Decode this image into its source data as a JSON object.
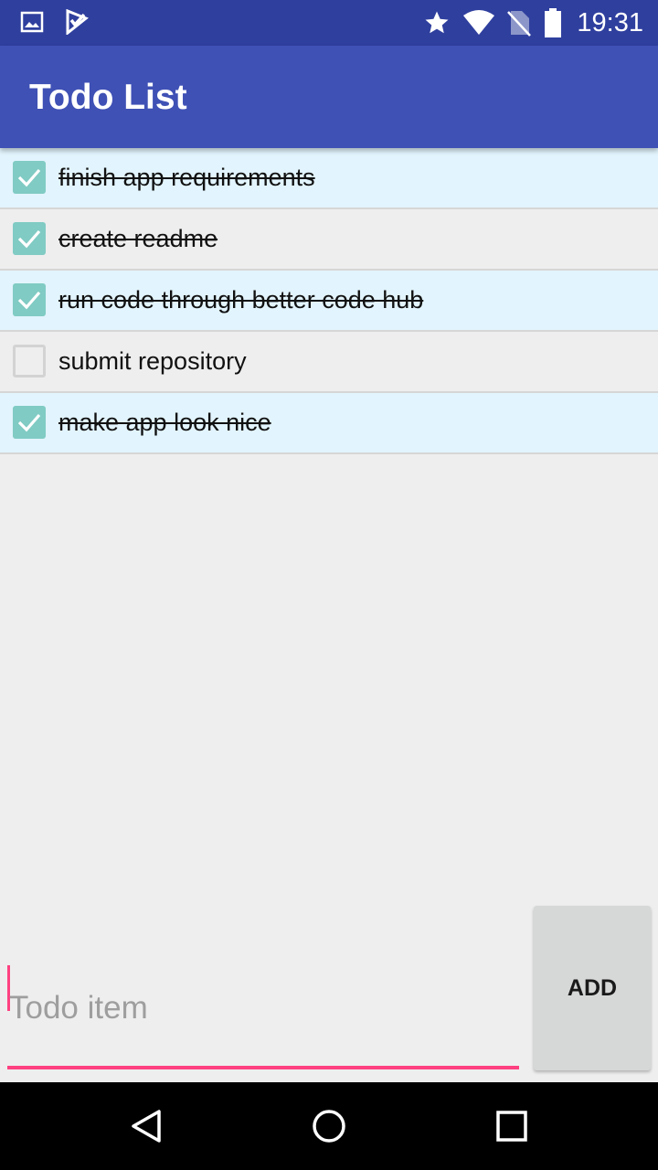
{
  "status_bar": {
    "time": "19:31",
    "icons": [
      "gallery-notification-icon",
      "app-notification-icon",
      "star-icon",
      "wifi-icon",
      "no-sim-icon",
      "battery-icon"
    ]
  },
  "app_bar": {
    "title": "Todo List"
  },
  "todos": [
    {
      "text": "finish app requirements",
      "done": true
    },
    {
      "text": "create readme",
      "done": true
    },
    {
      "text": "run code through better code hub",
      "done": true
    },
    {
      "text": "submit repository",
      "done": false
    },
    {
      "text": "make app look nice",
      "done": true
    }
  ],
  "input": {
    "placeholder": "Todo item",
    "value": ""
  },
  "add_button": {
    "label": "ADD"
  },
  "nav_bar": {
    "buttons": [
      "back-icon",
      "home-icon",
      "recent-apps-icon"
    ]
  },
  "colors": {
    "status_bar": "#2f3f9e",
    "app_bar": "#3f51b5",
    "accent": "#ff4081",
    "checkbox_checked": "#80cbc4",
    "row_highlight": "#e2f4fd"
  }
}
